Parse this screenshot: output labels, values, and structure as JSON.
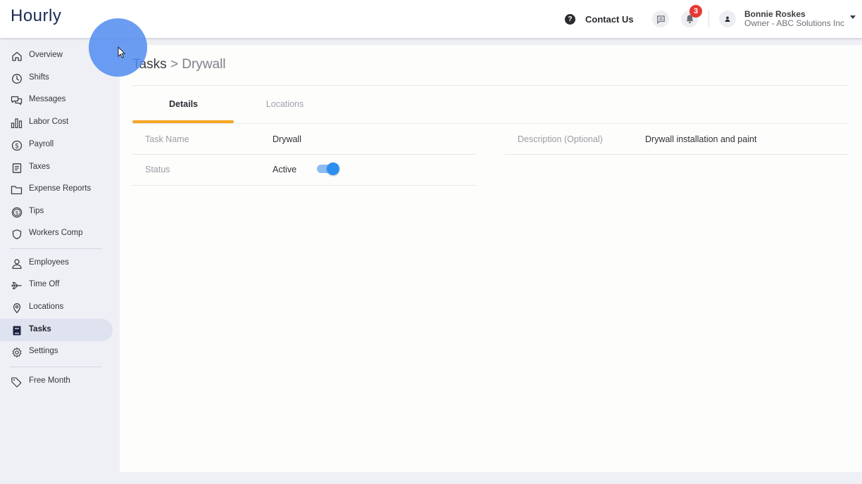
{
  "app": {
    "logo": "Hourly"
  },
  "header": {
    "help_icon": "help-circle-icon",
    "contact_label": "Contact Us",
    "messages_icon": "chat-icon",
    "notifications_icon": "bell-icon",
    "notification_count": "3",
    "user": {
      "name": "Bonnie Roskes",
      "role": "Owner - ABC Solutions Inc"
    }
  },
  "sidebar": {
    "items": [
      {
        "label": "Overview",
        "icon": "home-icon"
      },
      {
        "label": "Shifts",
        "icon": "clock-icon"
      },
      {
        "label": "Messages",
        "icon": "chat-bubbles-icon"
      },
      {
        "label": "Labor Cost",
        "icon": "bar-chart-icon"
      },
      {
        "label": "Payroll",
        "icon": "dollar-circle-icon"
      },
      {
        "label": "Taxes",
        "icon": "document-icon"
      },
      {
        "label": "Expense Reports",
        "icon": "folder-icon"
      },
      {
        "label": "Tips",
        "icon": "dollar-coin-icon"
      },
      {
        "label": "Workers Comp",
        "icon": "shield-icon"
      },
      {
        "label": "Employees",
        "icon": "person-icon"
      },
      {
        "label": "Time Off",
        "icon": "airplane-icon"
      },
      {
        "label": "Locations",
        "icon": "map-pin-icon"
      },
      {
        "label": "Tasks",
        "icon": "book-icon",
        "active": true
      },
      {
        "label": "Settings",
        "icon": "gear-icon"
      },
      {
        "label": "Free Month",
        "icon": "tag-icon"
      }
    ]
  },
  "main": {
    "breadcrumb": {
      "root": "Tasks",
      "separator": ">",
      "current": "Drywall"
    },
    "tabs": [
      {
        "label": "Details",
        "active": true
      },
      {
        "label": "Locations",
        "active": false
      }
    ],
    "fields": {
      "task_name_label": "Task Name",
      "task_name_value": "Drywall",
      "status_label": "Status",
      "status_value": "Active",
      "status_toggle_on": true,
      "description_label": "Description (Optional)",
      "description_value": "Drywall installation and paint"
    }
  },
  "colors": {
    "accent_tab": "#f5a623",
    "toggle_on": "#2c8ff0",
    "badge": "#e53935",
    "logo": "#1b2a57"
  }
}
